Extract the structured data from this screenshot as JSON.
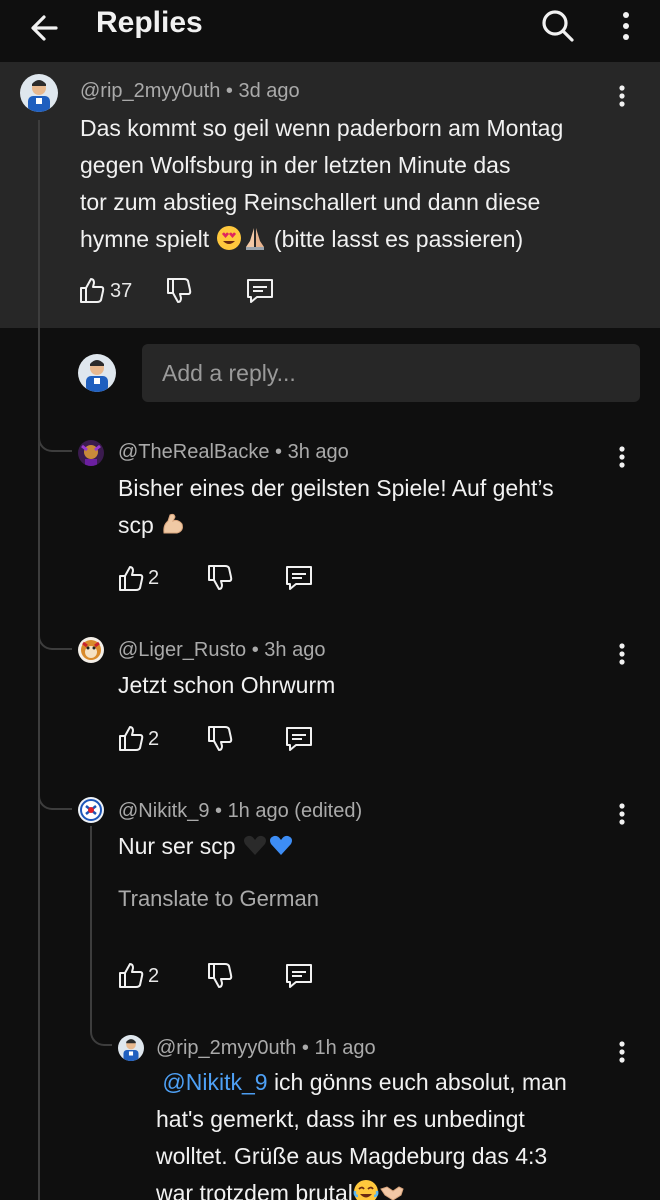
{
  "header": {
    "title": "Replies"
  },
  "parent_comment": {
    "author": "@rip_2myy0uth",
    "time": "3d ago",
    "text_line1": "Das kommt so geil wenn paderborn am Montag",
    "text_line2": "gegen Wolfsburg in der letzten Minute das",
    "text_line3": "tor zum abstieg Reinschallert und dann diese",
    "text_line4_before": "hymne spielt",
    "text_line4_after": "(bitte lasst es passieren)",
    "likes": "37"
  },
  "reply_input": {
    "placeholder": "Add a reply..."
  },
  "replies": [
    {
      "author": "@TheRealBacke",
      "time": "3h ago",
      "text_line1": "Bisher eines der geilsten Spiele! Auf geht’s",
      "text_line2": "scp",
      "likes": "2"
    },
    {
      "author": "@Liger_Rusto",
      "time": "3h ago",
      "text_line1": "Jetzt schon Ohrwurm",
      "likes": "2"
    },
    {
      "author": "@Nikitk_9",
      "time": "1h ago (edited)",
      "text_line1": "Nur ser scp",
      "translate": "Translate to German",
      "likes": "2"
    },
    {
      "author": "@rip_2myy0uth",
      "time": "1h ago",
      "mention": "@Nikitk_9",
      "text_line1": "ich gönns euch absolut, man",
      "text_line2": "hat's gemerkt, dass ihr es unbedingt",
      "text_line3": "wolltet. Grüße aus Magdeburg das 4:3",
      "text_line4": "war trotzdem brutal"
    }
  ],
  "colors": {
    "background": "#0f0f0f",
    "highlight": "#272727",
    "meta": "#aaaaaa",
    "link": "#4ea0f5"
  }
}
